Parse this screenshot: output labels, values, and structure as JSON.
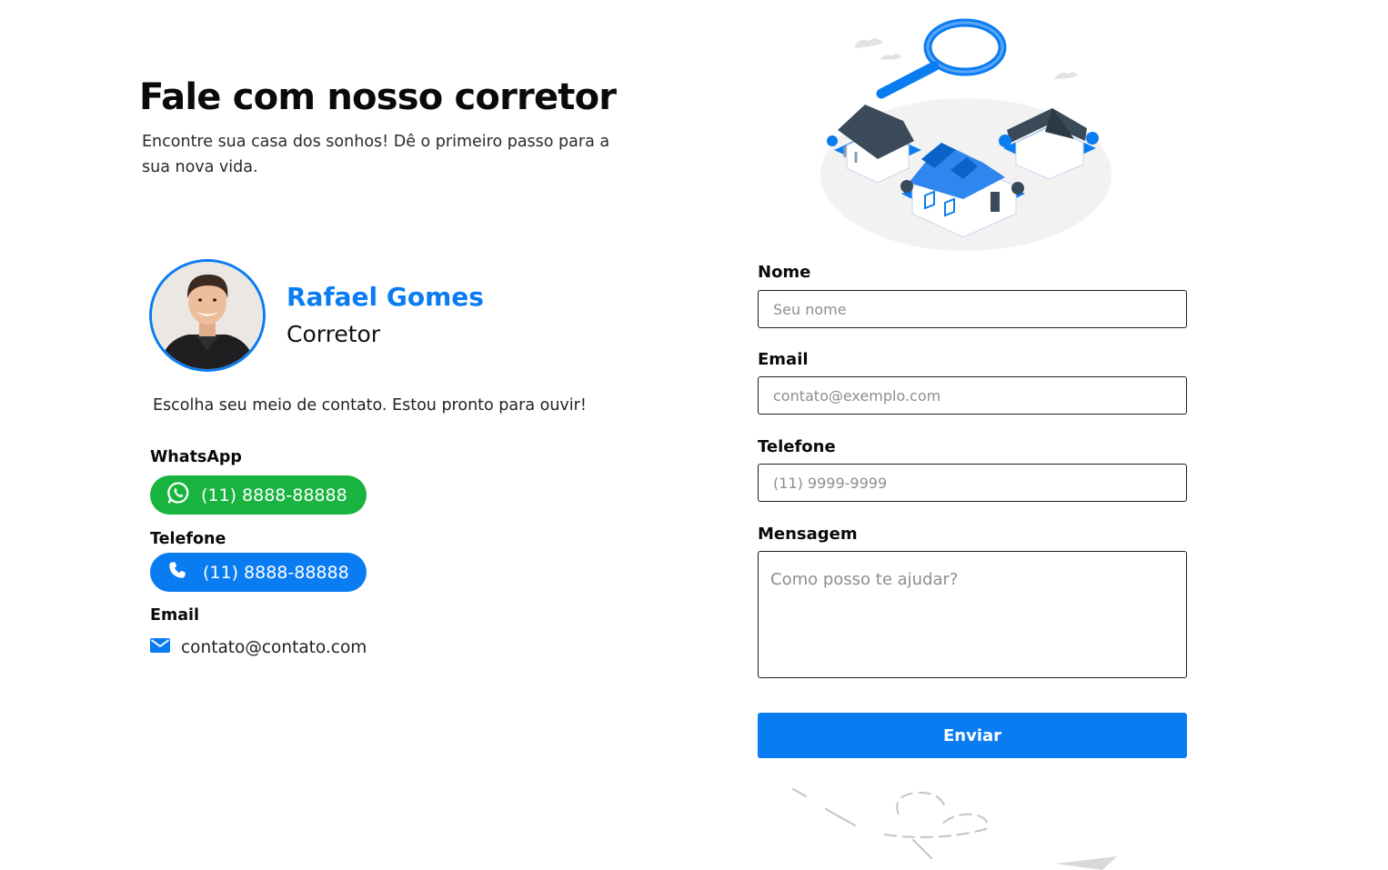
{
  "header": {
    "title": "Fale com nosso corretor",
    "subtitle": "Encontre sua casa dos sonhos! Dê o primeiro passo para a sua nova vida."
  },
  "agent": {
    "name": "Rafael Gomes",
    "role": "Corretor",
    "intro": "Escolha seu meio de contato. Estou pronto para ouvir!"
  },
  "contacts": {
    "whatsapp": {
      "label": "WhatsApp",
      "value": "(11) 8888-88888",
      "icon": "whatsapp-icon",
      "color": "#18b43f"
    },
    "phone": {
      "label": "Telefone",
      "value": "(11) 8888-88888",
      "icon": "phone-icon",
      "color": "#0a7cf2"
    },
    "email": {
      "label": "Email",
      "value": "contato@contato.com",
      "icon": "envelope-icon",
      "color": "#0a7cf2"
    }
  },
  "form": {
    "name": {
      "label": "Nome",
      "placeholder": "Seu nome"
    },
    "email": {
      "label": "Email",
      "placeholder": "contato@exemplo.com"
    },
    "phone": {
      "label": "Telefone",
      "placeholder": "(11) 9999-9999"
    },
    "message": {
      "label": "Mensagem",
      "placeholder": "Como posso te ajudar?"
    },
    "submit_label": "Enviar"
  },
  "theme": {
    "accent": "#0a7cf2",
    "whatsapp": "#18b43f"
  }
}
